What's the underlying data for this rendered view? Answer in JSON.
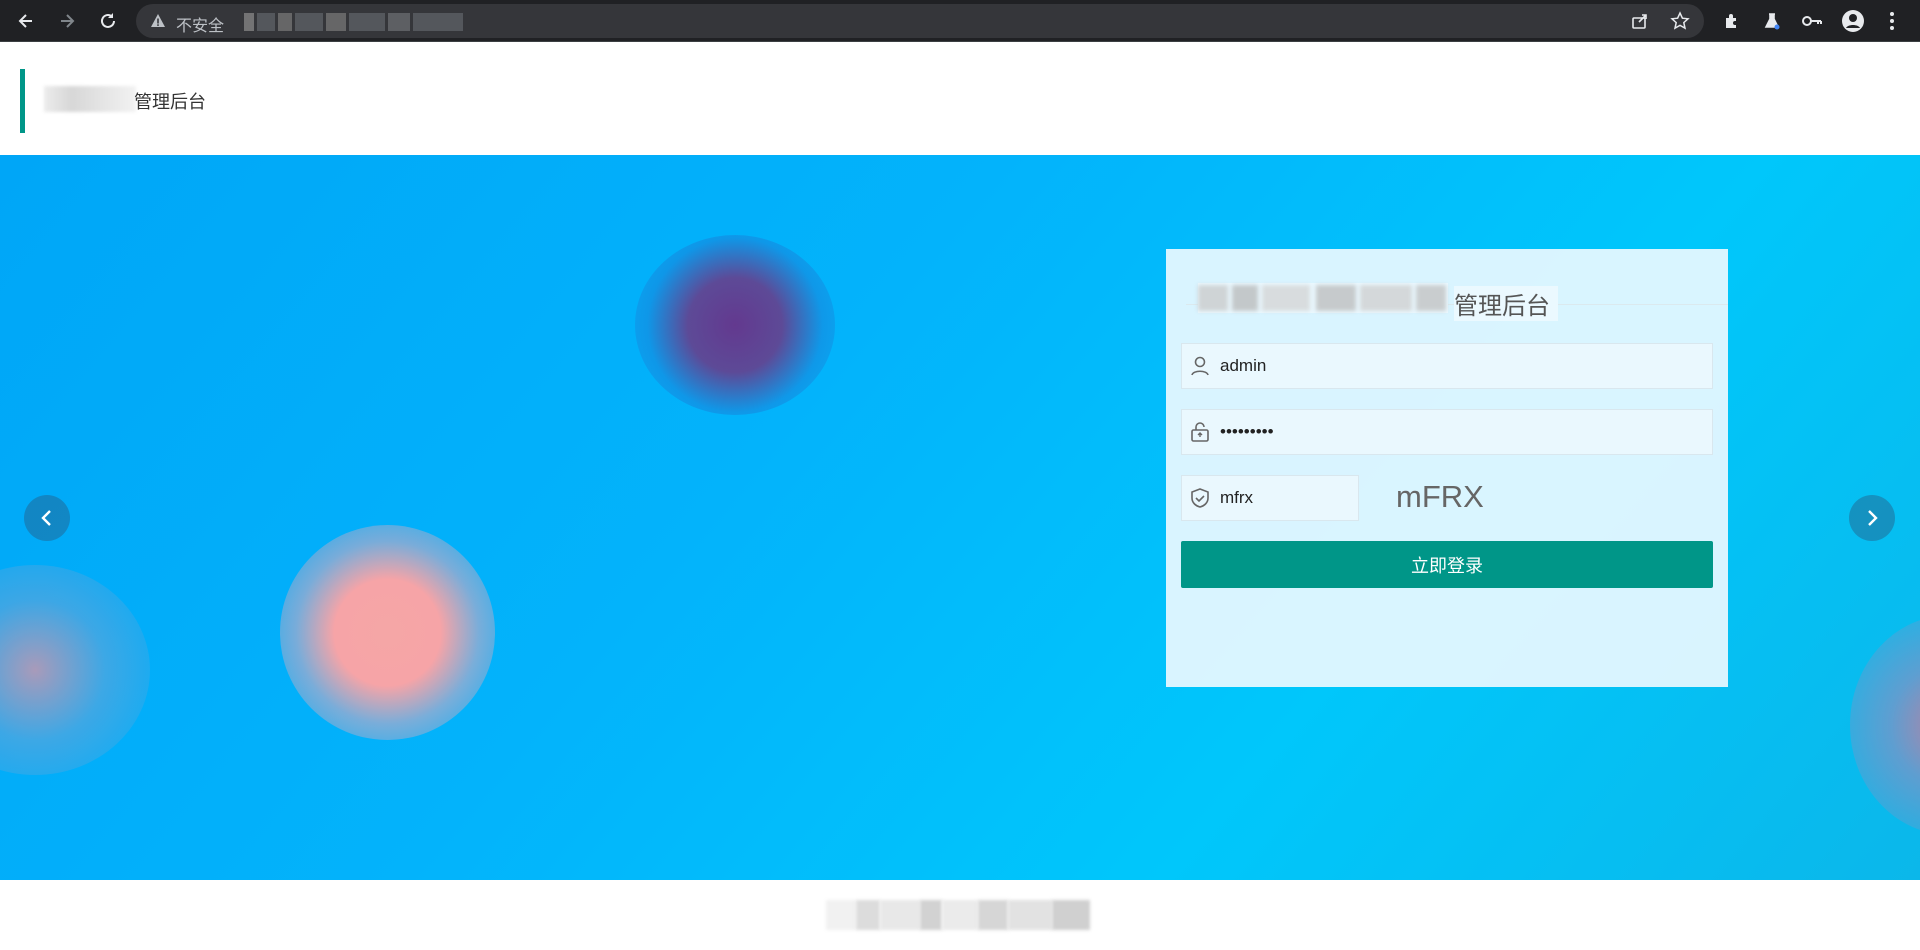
{
  "browser": {
    "security_label": "不安全",
    "address_redacted": true
  },
  "header": {
    "title_suffix": "管理后台",
    "accent_color": "#009688"
  },
  "hero": {
    "prev_label": "‹",
    "next_label": "›"
  },
  "login": {
    "title_suffix": "管理后台",
    "username": {
      "value": "admin"
    },
    "password": {
      "value": "•••••••••"
    },
    "captcha": {
      "value": "mfrx",
      "image_text": "mFRX"
    },
    "submit_label": "立即登录",
    "button_color": "#009688"
  },
  "footer": {
    "text_redacted": true
  }
}
